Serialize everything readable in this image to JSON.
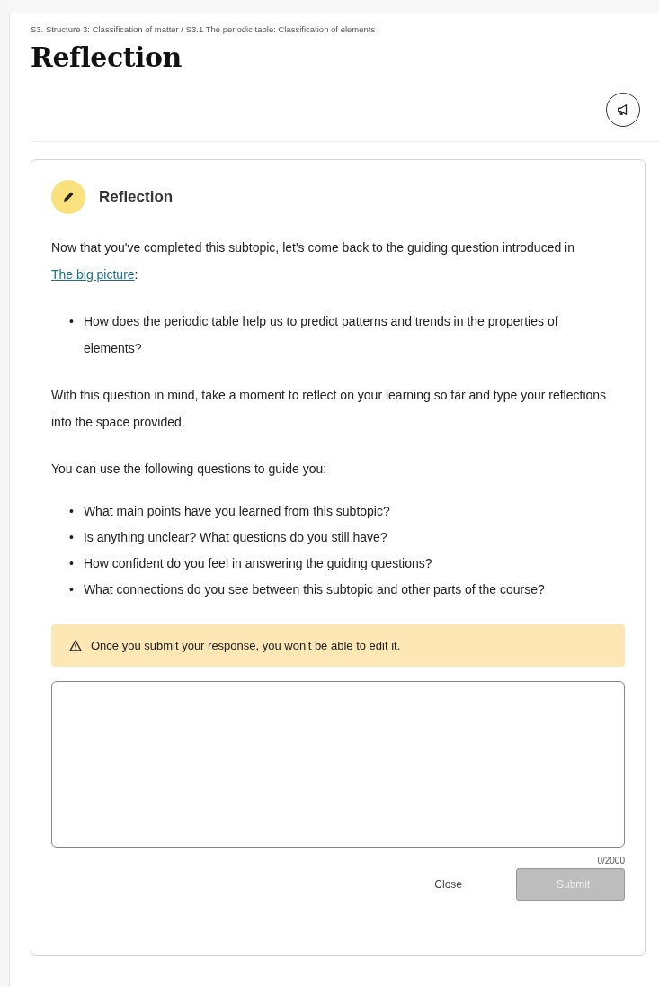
{
  "breadcrumb": "S3. Structure 3: Classification of matter / S3.1 The periodic table: Classification of elements",
  "title": "Reflection",
  "card": {
    "heading": "Reflection",
    "intro": {
      "before": "Now that you've completed this subtopic, let's come back to the guiding question introduced in ",
      "link": "The big picture",
      "after": ":"
    },
    "guiding_questions": [
      {
        "marker": "•",
        "text": "How does the periodic table help us to predict patterns and trends in the properties of elements?"
      }
    ],
    "prompt": "With this question in mind, take a moment to reflect on your learning so far and type your reflections into the space provided.",
    "guide_intro": "You can use the following questions to guide you:",
    "guide_questions": [
      {
        "marker": "•",
        "text": "What main points have you learned from this subtopic?"
      },
      {
        "marker": "•",
        "text": "Is anything unclear? What questions do you still have?"
      },
      {
        "marker": "•",
        "text": "How confident do you feel in answering the guiding questions?"
      },
      {
        "marker": "•",
        "text": "What connections do you see between this subtopic and other parts of the course?"
      }
    ],
    "warning": "Once you submit your response, you won't be able to edit it.",
    "counter": "0/2000",
    "buttons": [
      {
        "label": "Close",
        "kind": "text",
        "disabled": false
      },
      {
        "label": "Submit",
        "kind": "primary",
        "disabled": true
      }
    ]
  }
}
